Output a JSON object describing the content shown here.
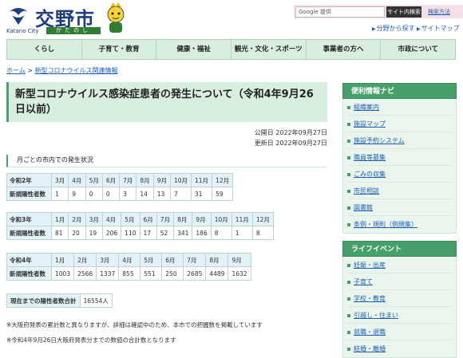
{
  "header": {
    "logo_text": "交野市",
    "logo_en": "Katano City",
    "logo_kana": "かたのし",
    "search": {
      "placeholder": "Google 提供",
      "button": "サイト内検索",
      "detail": "検索方法"
    },
    "util_links": [
      "分野から探す",
      "サイトマップ"
    ]
  },
  "nav": [
    "くらし",
    "子育て・教育",
    "健康・福祉",
    "観光・文化・スポーツ",
    "事業者の方へ",
    "市政について"
  ],
  "breadcrumb": {
    "home": "ホーム",
    "sep": ">",
    "current": "新型コロナウイルス関連情報"
  },
  "page": {
    "title": "新型コロナウイルス感染症患者の発生について（令和4年9月26日以前）",
    "published": "公開日 2022年09月27日",
    "updated": "更新日 2022年09月27日",
    "section_heading": "月ごとの市内での発生状況",
    "row_label": "新規陽性者数",
    "tables": [
      {
        "year": "令和2年",
        "months": [
          "3月",
          "4月",
          "5月",
          "6月",
          "7月",
          "8月",
          "9月",
          "10月",
          "11月",
          "12月"
        ],
        "values": [
          "1",
          "9",
          "0",
          "0",
          "3",
          "14",
          "13",
          "7",
          "31",
          "59"
        ]
      },
      {
        "year": "令和3年",
        "months": [
          "1月",
          "2月",
          "3月",
          "4月",
          "5月",
          "6月",
          "7月",
          "8月",
          "9月",
          "10月",
          "11月",
          "12月"
        ],
        "values": [
          "81",
          "20",
          "19",
          "206",
          "110",
          "17",
          "52",
          "341",
          "186",
          "8",
          "1",
          "8"
        ]
      },
      {
        "year": "令和4年",
        "months": [
          "1月",
          "2月",
          "3月",
          "4月",
          "5月",
          "6月",
          "7月",
          "8月",
          "9月"
        ],
        "values": [
          "1003",
          "2566",
          "1337",
          "855",
          "551",
          "250",
          "2685",
          "4489",
          "1632"
        ]
      }
    ],
    "total_label": "現在までの陽性者数合計",
    "total_value": "16554人",
    "notes": [
      "※大阪府発表の累計数と異なりますが、詳細は確認中のため、本市での把握数を掲載しています",
      "※令和4年9月26日大阪府発表分までの数値の合計数となります"
    ]
  },
  "sidebar": {
    "convenience": {
      "heading": "便利情報ナビ",
      "items": [
        "組織案内",
        "施設マップ",
        "施設予約システム",
        "職員等募集",
        "ごみの収集",
        "市民相談",
        "図書館",
        "条例・規則（例規集）"
      ]
    },
    "life": {
      "heading": "ライフイベント",
      "items": [
        "妊娠・出産",
        "子育て",
        "学校・教育",
        "引越し・住まい",
        "就職・退職",
        "結婚・離婚"
      ]
    }
  },
  "colors": {
    "accent_green": "#46a06b",
    "nav_bg": "#d8eedf",
    "table_head": "#e3f2fa",
    "brand_navy": "#1e3d7b"
  }
}
